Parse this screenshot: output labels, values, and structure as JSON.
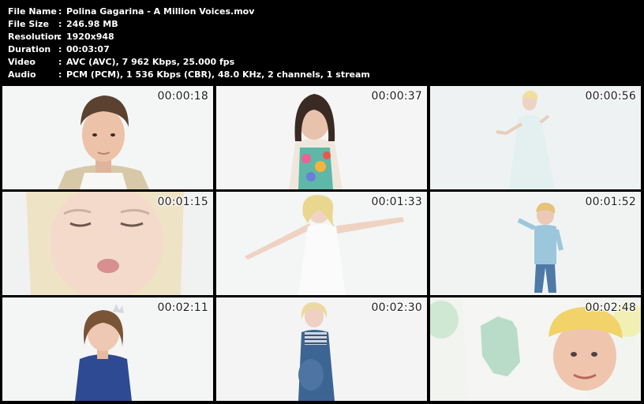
{
  "info": [
    {
      "label": "File Name",
      "value": "Polina Gagarina - A Million Voices.mov"
    },
    {
      "label": "File Size",
      "value": "246.98 MB"
    },
    {
      "label": "Resolution",
      "value": "1920x948"
    },
    {
      "label": "Duration",
      "value": "00:03:07"
    },
    {
      "label": "Video",
      "value": "AVC (AVC), 7 962 Kbps, 25.000 fps"
    },
    {
      "label": "Audio",
      "value": "PCM (PCM), 1 536 Kbps (CBR), 48.0 KHz, 2 channels, 1 stream"
    }
  ],
  "separator": ":",
  "thumbnails": [
    {
      "timestamp": "00:00:18",
      "subject": "boy-portrait"
    },
    {
      "timestamp": "00:00:37",
      "subject": "girl-floral-dress"
    },
    {
      "timestamp": "00:00:56",
      "subject": "woman-white-dress-distant"
    },
    {
      "timestamp": "00:01:15",
      "subject": "blonde-woman-closeup"
    },
    {
      "timestamp": "00:01:33",
      "subject": "woman-arms-outstretched"
    },
    {
      "timestamp": "00:01:52",
      "subject": "boy-jumping"
    },
    {
      "timestamp": "00:02:11",
      "subject": "little-girl-crown"
    },
    {
      "timestamp": "00:02:30",
      "subject": "pregnant-woman-striped"
    },
    {
      "timestamp": "00:02:48",
      "subject": "girl-yellow-hat-paint-hand"
    }
  ],
  "colors": {
    "background": "#000000",
    "info_text": "#ffffff",
    "timestamp_text": "#1e1e1e",
    "frame_bg": "#f3f5f5"
  }
}
